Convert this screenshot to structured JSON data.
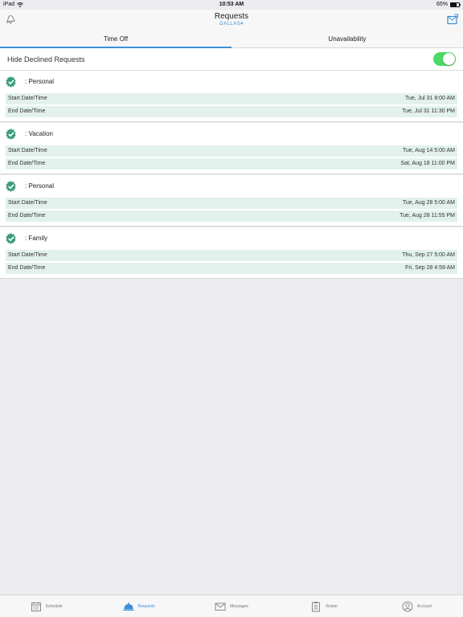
{
  "status_bar": {
    "device": "iPad",
    "time": "10:53 AM",
    "battery": "65%",
    "battery_level": 0.65
  },
  "nav": {
    "title": "Requests",
    "subtitle": "DALLAS",
    "left_icon": "bell-icon",
    "right_icon": "compose-icon"
  },
  "tabs": [
    {
      "label": "Time Off",
      "active": true
    },
    {
      "label": "Unavailability",
      "active": false
    }
  ],
  "toggle": {
    "label": "Hide Declined Requests",
    "on": true
  },
  "colors": {
    "accent": "#3d8fd4",
    "approved": "#3d9b7f",
    "row_bg": "#e2f1ec",
    "switch_on": "#4cd964"
  },
  "requests": [
    {
      "type": ": Personal",
      "start_label": "Start Date/Time",
      "start": "Tue, Jul 31 8:00 AM",
      "end_label": "End Date/Time",
      "end": "Tue, Jul 31 11:30 PM"
    },
    {
      "type": ": Vacation",
      "start_label": "Start Date/Time",
      "start": "Tue, Aug 14 5:00 AM",
      "end_label": "End Date/Time",
      "end": "Sat, Aug 18 11:00 PM"
    },
    {
      "type": ": Personal",
      "start_label": "Start Date/Time",
      "start": "Tue, Aug 28 5:00 AM",
      "end_label": "End Date/Time",
      "end": "Tue, Aug 28 11:55 PM"
    },
    {
      "type": ": Family",
      "start_label": "Start Date/Time",
      "start": "Thu, Sep 27 5:00 AM",
      "end_label": "End Date/Time",
      "end": "Fri, Sep 28 4:59 AM"
    }
  ],
  "tab_bar": [
    {
      "label": "Schedule",
      "icon": "calendar-icon",
      "active": false
    },
    {
      "label": "Requests",
      "icon": "service-bell-icon",
      "active": true
    },
    {
      "label": "Messages",
      "icon": "envelope-icon",
      "active": false
    },
    {
      "label": "Roster",
      "icon": "clipboard-icon",
      "active": false
    },
    {
      "label": "Account",
      "icon": "user-icon",
      "active": false
    }
  ]
}
